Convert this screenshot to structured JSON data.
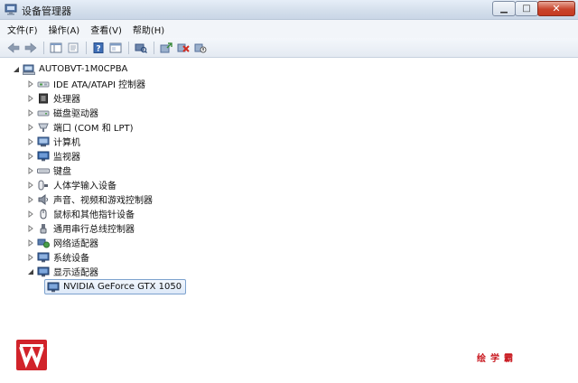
{
  "window": {
    "title": "设备管理器",
    "buttons": {
      "minimize": "▁",
      "maximize": "□",
      "close": "✕"
    }
  },
  "menu": [
    "文件(F)",
    "操作(A)",
    "查看(V)",
    "帮助(H)"
  ],
  "toolbar": {
    "icons": [
      "back-icon",
      "forward-icon",
      "console-tree-icon",
      "properties-icon",
      "help-icon",
      "view-icon",
      "scan-hardware-icon",
      "update-driver-icon",
      "uninstall-icon",
      "disable-icon"
    ]
  },
  "tree": {
    "root": "AUTOBVT-1M0CPBA",
    "categories": [
      {
        "label": "IDE ATA/ATAPI 控制器",
        "icon": "ide-controller-icon",
        "expanded": false
      },
      {
        "label": "处理器",
        "icon": "processor-icon",
        "expanded": false
      },
      {
        "label": "磁盘驱动器",
        "icon": "disk-drive-icon",
        "expanded": false
      },
      {
        "label": "端口 (COM 和 LPT)",
        "icon": "port-icon",
        "expanded": false
      },
      {
        "label": "计算机",
        "icon": "computer-icon",
        "expanded": false
      },
      {
        "label": "监视器",
        "icon": "monitor-icon",
        "expanded": false
      },
      {
        "label": "键盘",
        "icon": "keyboard-icon",
        "expanded": false
      },
      {
        "label": "人体学输入设备",
        "icon": "hid-icon",
        "expanded": false
      },
      {
        "label": "声音、视频和游戏控制器",
        "icon": "sound-icon",
        "expanded": false
      },
      {
        "label": "鼠标和其他指针设备",
        "icon": "mouse-icon",
        "expanded": false
      },
      {
        "label": "通用串行总线控制器",
        "icon": "usb-icon",
        "expanded": false
      },
      {
        "label": "网络适配器",
        "icon": "network-adapter-icon",
        "expanded": false
      },
      {
        "label": "系统设备",
        "icon": "system-device-icon",
        "expanded": false
      },
      {
        "label": "显示适配器",
        "icon": "display-adapter-icon",
        "expanded": true
      }
    ],
    "child": {
      "label": "NVIDIA GeForce GTX 1050",
      "icon": "display-adapter-icon",
      "selected": true
    }
  },
  "watermark": {
    "text": "绘学霸",
    "color": "#c8161d"
  }
}
